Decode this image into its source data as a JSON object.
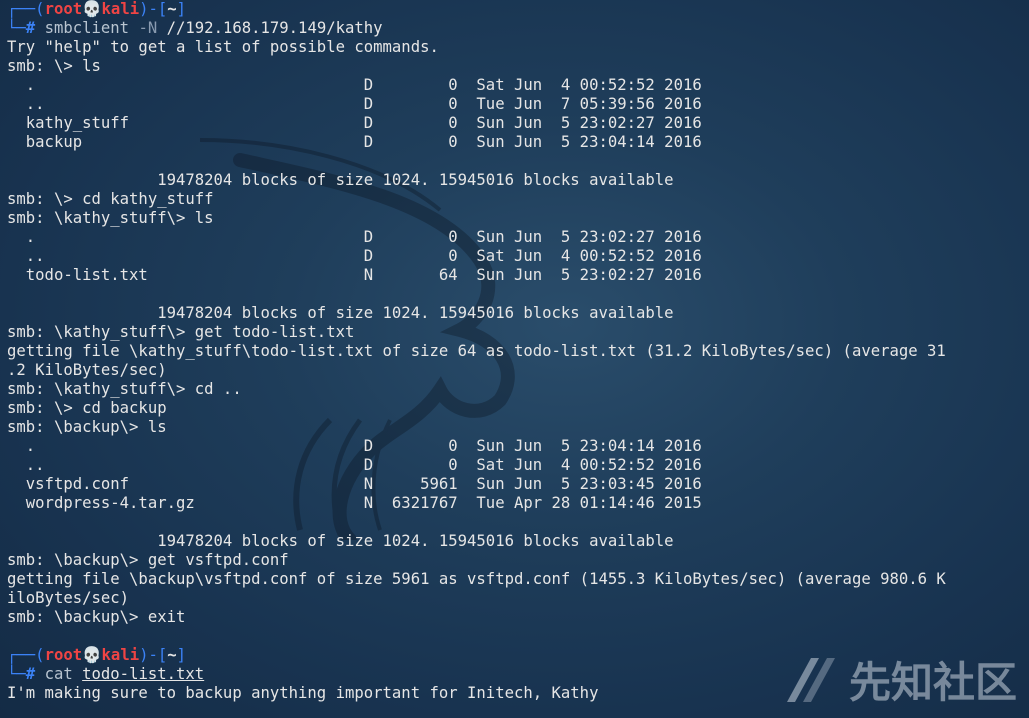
{
  "prompt": {
    "user": "root",
    "host": "kali",
    "dir": "~",
    "skull": "💀"
  },
  "lines": [
    "Try \"help\" to get a list of possible commands.",
    "smb: \\> ls",
    "  .                                   D        0  Sat Jun  4 00:52:52 2016",
    "  ..                                  D        0  Tue Jun  7 05:39:56 2016",
    "  kathy_stuff                         D        0  Sun Jun  5 23:02:27 2016",
    "  backup                              D        0  Sun Jun  5 23:04:14 2016",
    "",
    "                19478204 blocks of size 1024. 15945016 blocks available",
    "smb: \\> cd kathy_stuff",
    "smb: \\kathy_stuff\\> ls",
    "  .                                   D        0  Sun Jun  5 23:02:27 2016",
    "  ..                                  D        0  Sat Jun  4 00:52:52 2016",
    "  todo-list.txt                       N       64  Sun Jun  5 23:02:27 2016",
    "",
    "                19478204 blocks of size 1024. 15945016 blocks available",
    "smb: \\kathy_stuff\\> get todo-list.txt",
    "getting file \\kathy_stuff\\todo-list.txt of size 64 as todo-list.txt (31.2 KiloBytes/sec) (average 31",
    ".2 KiloBytes/sec)",
    "smb: \\kathy_stuff\\> cd ..",
    "smb: \\> cd backup",
    "smb: \\backup\\> ls",
    "  .                                   D        0  Sun Jun  5 23:04:14 2016",
    "  ..                                  D        0  Sat Jun  4 00:52:52 2016",
    "  vsftpd.conf                         N     5961  Sun Jun  5 23:03:45 2016",
    "  wordpress-4.tar.gz                  N  6321767  Tue Apr 28 01:14:46 2015",
    "",
    "                19478204 blocks of size 1024. 15945016 blocks available",
    "smb: \\backup\\> get vsftpd.conf",
    "getting file \\backup\\vsftpd.conf of size 5961 as vsftpd.conf (1455.3 KiloBytes/sec) (average 980.6 K",
    "iloBytes/sec)",
    "smb: \\backup\\> exit",
    ""
  ],
  "cmd1": {
    "name": "smbclient",
    "flag": "-N",
    "arg": "//192.168.179.149/kathy"
  },
  "cmd2": {
    "name": "cat",
    "arg": "todo-list.txt"
  },
  "final_output": "I'm making sure to backup anything important for Initech, Kathy",
  "watermark": "先知社区",
  "colors": {
    "user": "#ef4444",
    "frame": "#3b82f6",
    "background": "#1f3e5b"
  }
}
